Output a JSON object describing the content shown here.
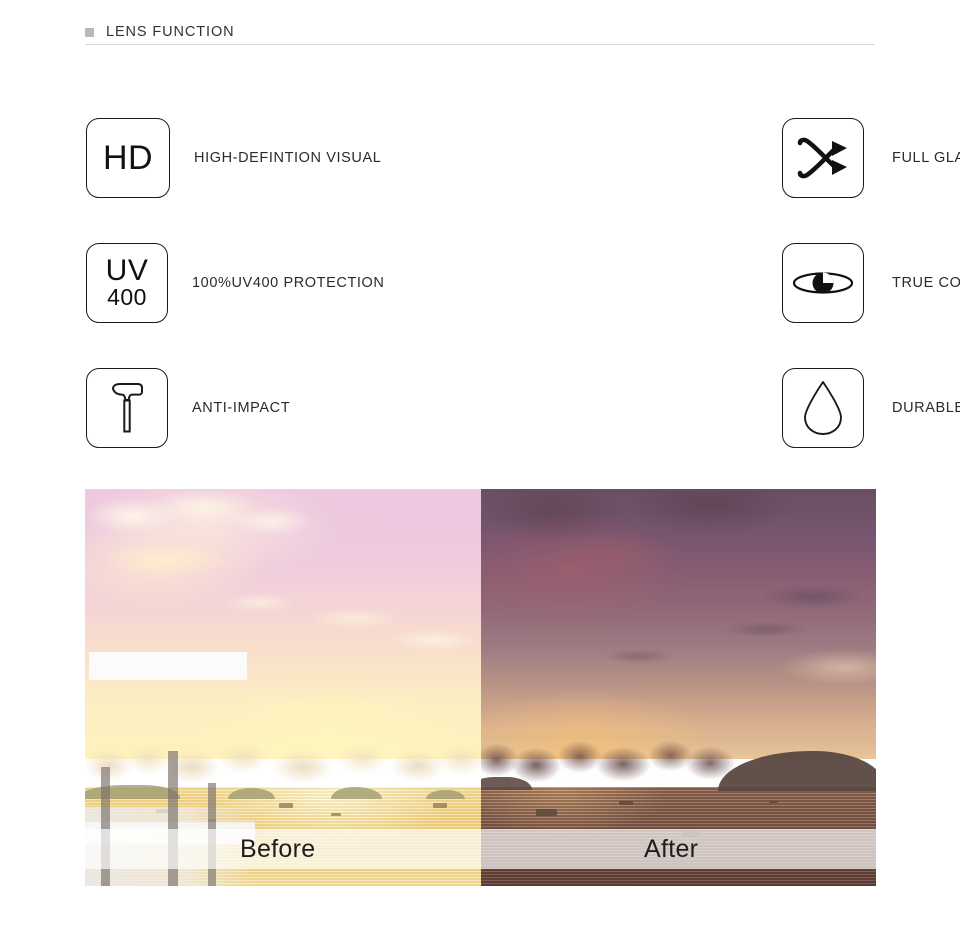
{
  "header": {
    "title": "LENS FUNCTION",
    "bullet_icon": "square-bullet-icon",
    "bullet_color": "#b9b9b9",
    "rule_color": "#d8d8d8"
  },
  "features": [
    {
      "icon_name": "hd-icon",
      "icon_type": "text",
      "icon_text": "HD",
      "label": "HIGH-DEFINTION VISUAL"
    },
    {
      "icon_name": "glare-barrier-cross-arrows-icon",
      "icon_type": "svg",
      "icon_text": "",
      "label": "FULL GLARE BARRIER"
    },
    {
      "icon_name": "uv400-icon",
      "icon_type": "text-stack",
      "icon_text_top": "UV",
      "icon_text_bottom": "400",
      "label": "100%UV400 PROTECTION"
    },
    {
      "icon_name": "eye-icon",
      "icon_type": "svg",
      "icon_text": "",
      "label": "TRUE COLOR"
    },
    {
      "icon_name": "hammer-icon",
      "icon_type": "svg",
      "icon_text": "",
      "label": "ANTI-IMPACT"
    },
    {
      "icon_name": "water-droplet-icon",
      "icon_type": "svg",
      "icon_text": "",
      "label": "DURABLE AND EASY TO CLEAN"
    }
  ],
  "comparison": {
    "before_label": "Before",
    "after_label": "After",
    "label_text_color": "#1d1d1d",
    "band_color": "rgba(255,255,255,0.68)",
    "before_description": "washed-out pastel sunset seascape with pink sky, pale yellow sea, islands and a white pier",
    "after_description": "saturated contrasty sunset seascape with purple-mauve sky, dark clouds, amber sea and a dark headland"
  },
  "colors": {
    "text_primary": "#2b2b2b",
    "text_header": "#333333",
    "icon_stroke": "#1a1a1a",
    "page_background": "#ffffff"
  }
}
